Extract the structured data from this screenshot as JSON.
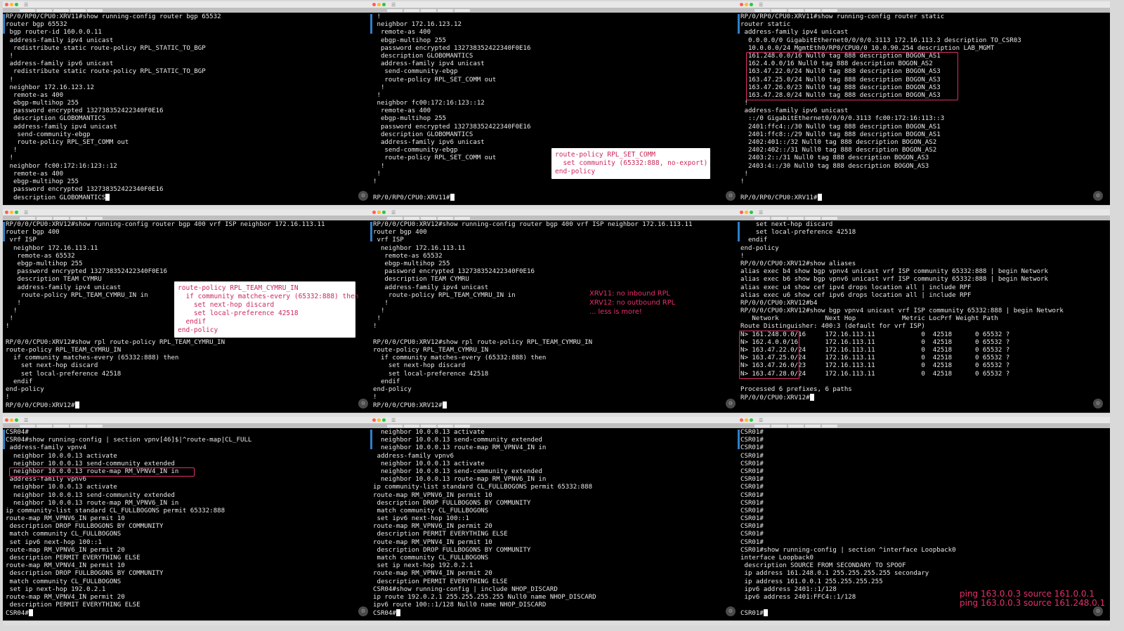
{
  "ui": {
    "icons": {
      "gear": "settings-gear-icon",
      "menu": "terminal-menu-icon"
    },
    "colors": {
      "terminal_bg": "#000000",
      "terminal_text": "#e9e9e9",
      "highlight": "#e0306a",
      "callout_text": "#cc2758"
    }
  },
  "panels": [
    {
      "lines": [
        "RP/0/RP0/CPU0:XRV11#show running-config router bgp 65532",
        "router bgp 65532",
        " bgp router-id 160.0.0.11",
        " address-family ipv4 unicast",
        "  redistribute static route-policy RPL_STATIC_TO_BGP",
        " !",
        " address-family ipv6 unicast",
        "  redistribute static route-policy RPL_STATIC_TO_BGP",
        " !",
        " neighbor 172.16.123.12",
        "  remote-as 400",
        "  ebgp-multihop 255",
        "  password encrypted 132738352422340F0E16",
        "  description GLOBOMANTICS",
        "  address-family ipv4 unicast",
        "   send-community-ebgp",
        "   route-policy RPL_SET_COMM out",
        "  !",
        " !",
        " neighbor fc00:172:16:123::12",
        "  remote-as 400",
        "  ebgp-multihop 255",
        "  password encrypted 132738352422340F0E16",
        "  description GLOBOMANTICS"
      ]
    },
    {
      "lines": [
        " !",
        " neighbor 172.16.123.12",
        "  remote-as 400",
        "  ebgp-multihop 255",
        "  password encrypted 132738352422340F0E16",
        "  description GLOBOMANTICS",
        "  address-family ipv4 unicast",
        "   send-community-ebgp",
        "   route-policy RPL_SET_COMM out",
        "  !",
        " !",
        " neighbor fc00:172:16:123::12",
        "  remote-as 400",
        "  ebgp-multihop 255",
        "  password encrypted 132738352422340F0E16",
        "  description GLOBOMANTICS",
        "  address-family ipv6 unicast",
        "   send-community-ebgp",
        "   route-policy RPL_SET_COMM out",
        "  !",
        " !",
        "!",
        "",
        "RP/0/RP0/CPU0:XRV11#"
      ],
      "callout": "route-policy RPL_SET_COMM\n  set community (65332:888, no-export)\nend-policy"
    },
    {
      "lines": [
        "RP/0/RP0/CPU0:XRV11#show running-config router static",
        "router static",
        " address-family ipv4 unicast",
        "  0.0.0.0/0 GigabitEthernet0/0/0/0.3113 172.16.113.3 description TO_CSR03",
        "  10.0.0.0/24 MgmtEth0/RP0/CPU0/0 10.0.90.254 description LAB_MGMT",
        "  161.248.0.0/16 Null0 tag 888 description BOGON_AS1",
        "  162.4.0.0/16 Null0 tag 888 description BOGON_AS2",
        "  163.47.22.0/24 Null0 tag 888 description BOGON_AS3",
        "  163.47.25.0/24 Null0 tag 888 description BOGON_AS3",
        "  163.47.26.0/23 Null0 tag 888 description BOGON_AS3",
        "  163.47.28.0/24 Null0 tag 888 description BOGON_AS3",
        " !",
        " address-family ipv6 unicast",
        "  ::/0 GigabitEthernet0/0/0/0.3113 fc00:172:16:113::3",
        "  2401:ffc4::/30 Null0 tag 888 description BOGON_AS1",
        "  2401:ffc8::/29 Null0 tag 888 description BOGON_AS1",
        "  2402:401::/32 Null0 tag 888 description BOGON_AS2",
        "  2402:402::/31 Null0 tag 888 description BOGON_AS2",
        "  2403:2::/31 Null0 tag 888 description BOGON_AS3",
        "  2403:4::/30 Null0 tag 888 description BOGON_AS3",
        " !",
        "!",
        "",
        "RP/0/RP0/CPU0:XRV11#"
      ]
    },
    {
      "lines": [
        "RP/0/0/CPU0:XRV12#show running-config router bgp 400 vrf ISP neighbor 172.16.113.11",
        "router bgp 400",
        " vrf ISP",
        "  neighbor 172.16.113.11",
        "   remote-as 65532",
        "   ebgp-multihop 255",
        "   password encrypted 132738352422340F0E16",
        "   description TEAM CYMRU",
        "   address-family ipv4 unicast",
        "    route-policy RPL_TEAM_CYMRU_IN in",
        "   !",
        "  !",
        " !",
        "!",
        "",
        "RP/0/0/CPU0:XRV12#show rpl route-policy RPL_TEAM_CYMRU_IN",
        "route-policy RPL_TEAM_CYMRU_IN",
        "  if community matches-every (65332:888) then",
        "    set next-hop discard",
        "    set local-preference 42518",
        "  endif",
        "end-policy",
        "!",
        "RP/0/0/CPU0:XRV12#"
      ],
      "callout": "route-policy RPL_TEAM_CYMRU_IN\n  if community matches-every (65332:888) then\n    set next-hop discard\n    set local-preference 42518\n  endif\nend-policy"
    },
    {
      "lines": [
        "RP/0/0/CPU0:XRV12#show running-config router bgp 400 vrf ISP neighbor 172.16.113.11",
        "router bgp 400",
        " vrf ISP",
        "  neighbor 172.16.113.11",
        "   remote-as 65532",
        "   ebgp-multihop 255",
        "   password encrypted 132738352422340F0E16",
        "   description TEAM CYMRU",
        "   address-family ipv4 unicast",
        "    route-policy RPL_TEAM_CYMRU_IN in",
        "   !",
        "  !",
        " !",
        "!",
        "",
        "RP/0/0/CPU0:XRV12#show rpl route-policy RPL_TEAM_CYMRU_IN",
        "route-policy RPL_TEAM_CYMRU_IN",
        "  if community matches-every (65332:888) then",
        "    set next-hop discard",
        "    set local-preference 42518",
        "  endif",
        "end-policy",
        "!",
        "RP/0/0/CPU0:XRV12#"
      ],
      "note": "XRV11: no inbound RPL\nXRV12: no outbound RPL\n... less is more!"
    },
    {
      "lines": [
        "    set next-hop discard",
        "    set local-preference 42518",
        "  endif",
        "end-policy",
        "!",
        "RP/0/0/CPU0:XRV12#show aliases",
        "alias exec b4 show bgp vpnv4 unicast vrf ISP community 65332:888 | begin Network",
        "alias exec b6 show bgp vpnv6 unicast vrf ISP community 65332:888 | begin Network",
        "alias exec u4 show cef ipv4 drops location all | include RPF",
        "alias exec u6 show cef ipv6 drops location all | include RPF",
        "RP/0/0/CPU0:XRV12#b4",
        "RP/0/0/CPU0:XRV12#show bgp vpnv4 unicast vrf ISP community 65332:888 | begin Network",
        "   Network            Next Hop            Metric LocPrf Weight Path",
        "Route Distinguisher: 400:3 (default for vrf ISP)",
        "N> 161.248.0.0/16     172.16.113.11            0  42518      0 65532 ?",
        "N> 162.4.0.0/16       172.16.113.11            0  42518      0 65532 ?",
        "N> 163.47.22.0/24     172.16.113.11            0  42518      0 65532 ?",
        "N> 163.47.25.0/24     172.16.113.11            0  42518      0 65532 ?",
        "N> 163.47.26.0/23     172.16.113.11            0  42518      0 65532 ?",
        "N> 163.47.28.0/24     172.16.113.11            0  42518      0 65532 ?",
        "",
        "Processed 6 prefixes, 6 paths",
        "RP/0/0/CPU0:XRV12#"
      ]
    },
    {
      "lines": [
        "CSR04#",
        "CSR04#show running-config | section vpnv[46]$|^route-map|CL_FULL",
        " address-family vpnv4",
        "  neighbor 10.0.0.13 activate",
        "  neighbor 10.0.0.13 send-community extended",
        "  neighbor 10.0.0.13 route-map RM_VPNV4_IN in",
        " address-family vpnv6",
        "  neighbor 10.0.0.13 activate",
        "  neighbor 10.0.0.13 send-community extended",
        "  neighbor 10.0.0.13 route-map RM_VPNV6_IN in",
        "ip community-list standard CL_FULLBOGONS permit 65332:888",
        "route-map RM_VPNV6_IN permit 10",
        " description DROP FULLBOGONS BY COMMUNITY",
        " match community CL_FULLBOGONS",
        " set ipv6 next-hop 100::1",
        "route-map RM_VPNV6_IN permit 20",
        " description PERMIT EVERYTHING ELSE",
        "route-map RM_VPNV4_IN permit 10",
        " description DROP FULLBOGONS BY COMMUNITY",
        " match community CL_FULLBOGONS",
        " set ip next-hop 192.0.2.1",
        "route-map RM_VPNV4_IN permit 20",
        " description PERMIT EVERYTHING ELSE",
        "CSR04#"
      ]
    },
    {
      "lines": [
        "  neighbor 10.0.0.13 activate",
        "  neighbor 10.0.0.13 send-community extended",
        "  neighbor 10.0.0.13 route-map RM_VPNV4_IN in",
        " address-family vpnv6",
        "  neighbor 10.0.0.13 activate",
        "  neighbor 10.0.0.13 send-community extended",
        "  neighbor 10.0.0.13 route-map RM_VPNV6_IN in",
        "ip community-list standard CL_FULLBOGONS permit 65332:888",
        "route-map RM_VPNV6_IN permit 10",
        " description DROP FULLBOGONS BY COMMUNITY",
        " match community CL_FULLBOGONS",
        " set ipv6 next-hop 100::1",
        "route-map RM_VPNV6_IN permit 20",
        " description PERMIT EVERYTHING ELSE",
        "route-map RM_VPNV4_IN permit 10",
        " description DROP FULLBOGONS BY COMMUNITY",
        " match community CL_FULLBOGONS",
        " set ip next-hop 192.0.2.1",
        "route-map RM_VPNV4_IN permit 20",
        " description PERMIT EVERYTHING ELSE",
        "CSR04#show running-config | include NHOP_DISCARD",
        "ip route 192.0.2.1 255.255.255.255 Null0 name NHOP_DISCARD",
        "ipv6 route 100::1/128 Null0 name NHOP_DISCARD",
        "CSR04#"
      ]
    },
    {
      "lines": [
        "CSR01#",
        "CSR01#",
        "CSR01#",
        "CSR01#",
        "CSR01#",
        "CSR01#",
        "CSR01#",
        "CSR01#",
        "CSR01#",
        "CSR01#",
        "CSR01#",
        "CSR01#",
        "CSR01#",
        "CSR01#",
        "CSR01#",
        "CSR01#show running-config | section ^interface Loopback0",
        "interface Loopback0",
        " description SOURCE FROM SECONDARY TO SPOOF",
        " ip address 161.248.0.1 255.255.255.255 secondary",
        " ip address 161.0.0.1 255.255.255.255",
        " ipv6 address 2401::1/128",
        " ipv6 address 2401:FFC4::1/128",
        "",
        "CSR01#"
      ],
      "note": "ping 163.0.0.3 source 161.0.0.1\nping 163.0.0.3 source 161.248.0.1"
    }
  ]
}
